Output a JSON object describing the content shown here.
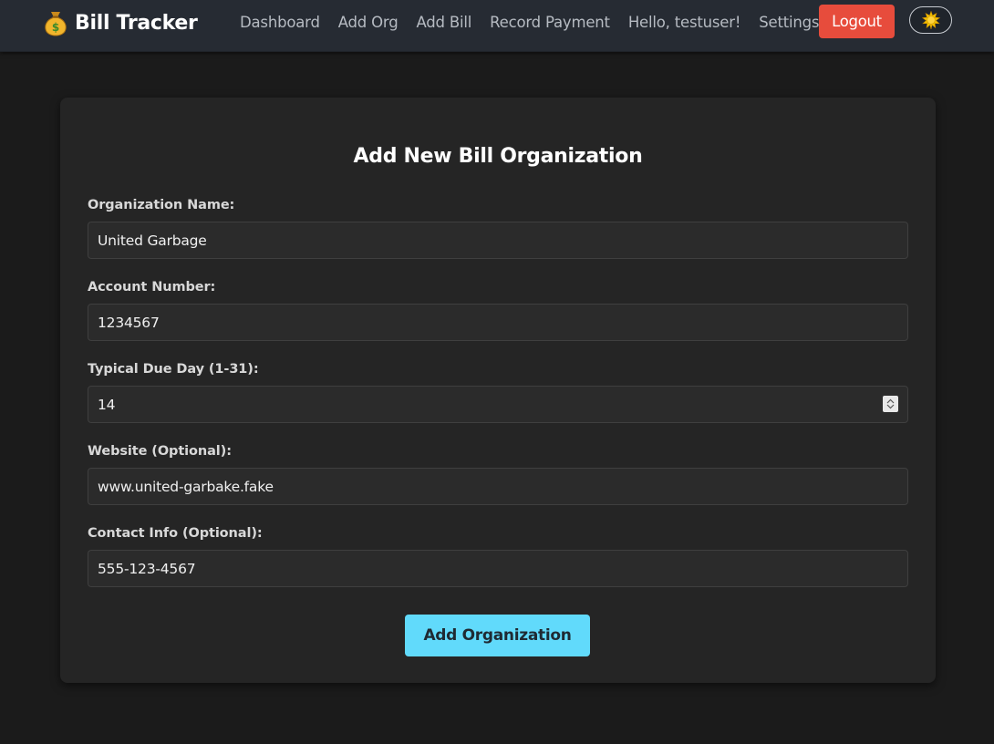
{
  "app": {
    "title": "Bill Tracker",
    "brand_icon": "money-bag-icon"
  },
  "nav": {
    "links": [
      "Dashboard",
      "Add Org",
      "Add Bill",
      "Record Payment"
    ],
    "greeting": "Hello, testuser!",
    "settings": "Settings",
    "logout": "Logout",
    "theme_toggle_icon": "sun-icon"
  },
  "form": {
    "title": "Add New Bill Organization",
    "fields": [
      {
        "label": "Organization Name:",
        "value": "United Garbage"
      },
      {
        "label": "Account Number:",
        "value": "1234567"
      },
      {
        "label": "Typical Due Day (1-31):",
        "value": "14"
      },
      {
        "label": "Website (Optional):",
        "value": "www.united-garbake.fake"
      },
      {
        "label": "Contact Info (Optional):",
        "value": "555-123-4567"
      }
    ],
    "submit": "Add Organization"
  },
  "colors": {
    "navbar_bg": "#262b33",
    "page_bg": "#1b1b1b",
    "card_bg": "#252525",
    "logout_bg": "#e74c3c",
    "submit_bg": "#61dafb"
  }
}
